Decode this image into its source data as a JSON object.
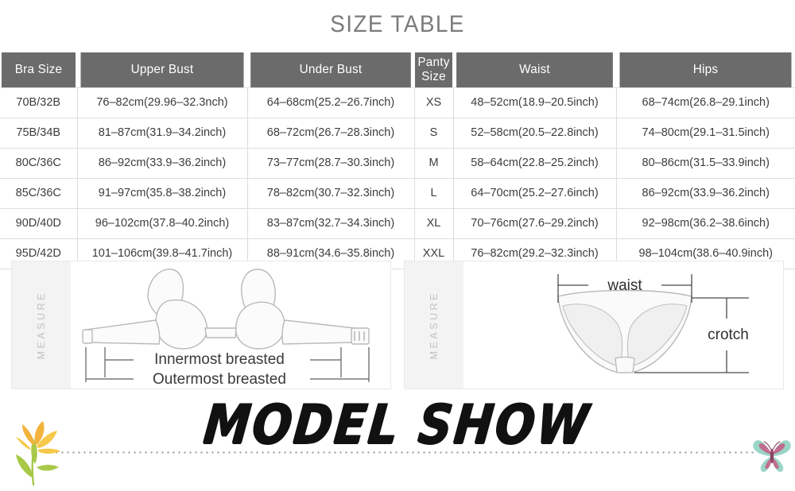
{
  "title": "SIZE TABLE",
  "table": {
    "headers": [
      "Bra Size",
      "Upper Bust",
      "Under Bust",
      "Panty Size",
      "Waist",
      "Hips"
    ],
    "rows": [
      {
        "bra_size": "70B/32B",
        "upper_bust": "76–82cm(29.96–32.3nch)",
        "under_bust": "64–68cm(25.2–26.7inch)",
        "panty_size": "XS",
        "waist": "48–52cm(18.9–20.5inch)",
        "hips": "68–74cm(26.8–29.1inch)"
      },
      {
        "bra_size": "75B/34B",
        "upper_bust": "81–87cm(31.9–34.2inch)",
        "under_bust": "68–72cm(26.7–28.3inch)",
        "panty_size": "S",
        "waist": "52–58cm(20.5–22.8inch)",
        "hips": "74–80cm(29.1–31.5inch)"
      },
      {
        "bra_size": "80C/36C",
        "upper_bust": "86–92cm(33.9–36.2inch)",
        "under_bust": "73–77cm(28.7–30.3inch)",
        "panty_size": "M",
        "waist": "58–64cm(22.8–25.2inch)",
        "hips": "80–86cm(31.5–33.9inch)"
      },
      {
        "bra_size": "85C/36C",
        "upper_bust": "91–97cm(35.8–38.2inch)",
        "under_bust": "78–82cm(30.7–32.3inch)",
        "panty_size": "L",
        "waist": "64–70cm(25.2–27.6inch)",
        "hips": "86–92cm(33.9–36.2inch)"
      },
      {
        "bra_size": "90D/40D",
        "upper_bust": "96–102cm(37.8–40.2inch)",
        "under_bust": "83–87cm(32.7–34.3inch)",
        "panty_size": "XL",
        "waist": "70–76cm(27.6–29.2inch)",
        "hips": "92–98cm(36.2–38.6inch)"
      },
      {
        "bra_size": "95D/42D",
        "upper_bust": "101–106cm(39.8–41.7inch)",
        "under_bust": "88–91cm(34.6–35.8inch)",
        "panty_size": "XXL",
        "waist": "76–82cm(29.2–32.3inch)",
        "hips": "98–104cm(38.6–40.9inch)"
      }
    ]
  },
  "panels": {
    "bra": {
      "tab_label": "MEASURE",
      "labels": {
        "innermost": "Innermost breasted",
        "outermost": "Outermost breasted"
      }
    },
    "panty": {
      "tab_label": "MEASURE",
      "labels": {
        "waist": "waist",
        "crotch": "crotch"
      }
    }
  },
  "banner": {
    "heading": "MODEL SHOW"
  },
  "colors": {
    "header_bg": "#6b6b6b",
    "title_text": "#7b7b7b",
    "cell_text": "#3d3d3d",
    "border": "#dedede",
    "measure_tab_bg": "#f3f3f3",
    "measure_tab_text": "#c2c2c2",
    "diagram_stroke": "#b9b9b9",
    "heading_text": "#111111",
    "flower_petal": "#f5c043",
    "flower_stem": "#9fc33f",
    "butterfly_wing": "#95d3c3",
    "butterfly_body": "#c75b86"
  }
}
